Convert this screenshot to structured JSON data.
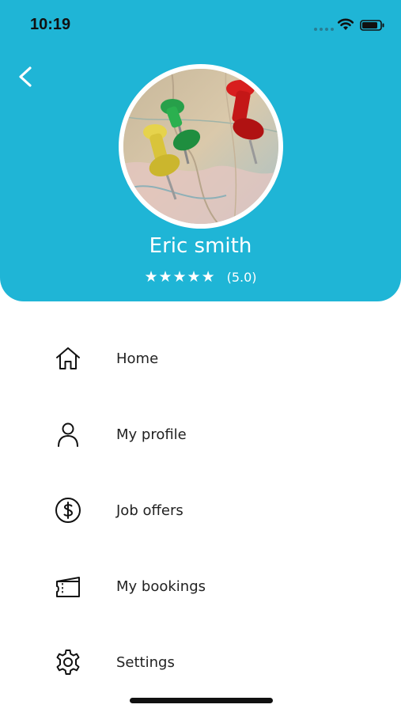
{
  "status_bar": {
    "time": "10:19"
  },
  "profile": {
    "name": "Eric smith",
    "stars": "★★★★★",
    "rating": "(5.0)",
    "rating_value": 5.0,
    "rating_max": 5
  },
  "menu": {
    "items": [
      {
        "label": "Home",
        "icon": "home-icon"
      },
      {
        "label": "My profile",
        "icon": "user-icon"
      },
      {
        "label": "Job offers",
        "icon": "dollar-icon"
      },
      {
        "label": "My bookings",
        "icon": "ticket-icon"
      },
      {
        "label": "Settings",
        "icon": "gear-icon"
      }
    ]
  },
  "colors": {
    "header": "#1fb5d6",
    "text": "#222222"
  }
}
